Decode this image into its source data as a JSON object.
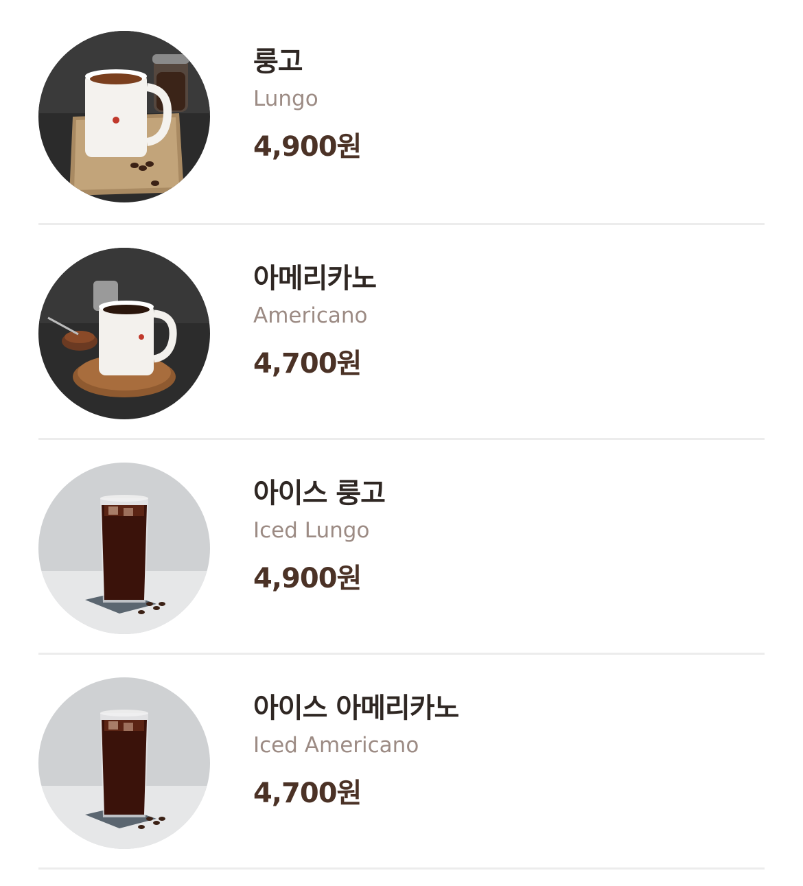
{
  "colors": {
    "name": "#2f2723",
    "english_name": "#9c8b84",
    "price": "#4b3226",
    "divider": "#ececec"
  },
  "menu": {
    "items": [
      {
        "name_ko": "룽고",
        "name_en": "Lungo",
        "price": "4,900원",
        "image": "hot-coffee-mug-photo"
      },
      {
        "name_ko": "아메리카노",
        "name_en": "Americano",
        "price": "4,700원",
        "image": "hot-coffee-mug-photo"
      },
      {
        "name_ko": "아이스 룽고",
        "name_en": "Iced Lungo",
        "price": "4,900원",
        "image": "iced-coffee-glass-photo"
      },
      {
        "name_ko": "아이스 아메리카노",
        "name_en": "Iced Americano",
        "price": "4,700원",
        "image": "iced-coffee-glass-photo"
      }
    ]
  }
}
